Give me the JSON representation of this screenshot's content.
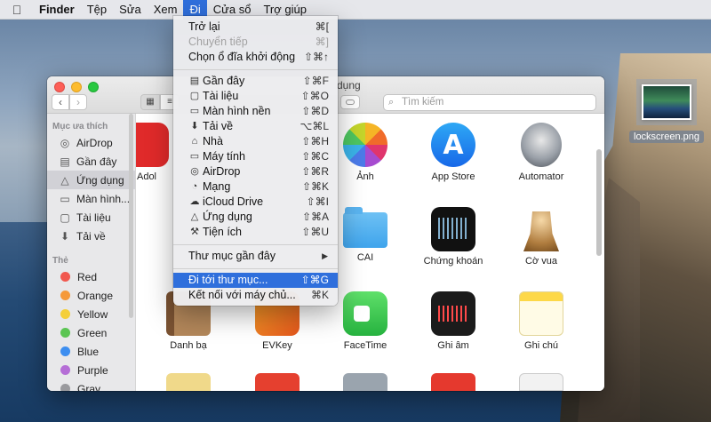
{
  "menubar": {
    "app": "Finder",
    "items": [
      "Tệp",
      "Sửa",
      "Xem",
      "Đi",
      "Cửa sổ",
      "Trợ giúp"
    ],
    "active": "Đi"
  },
  "window": {
    "title": "Ứng dụng",
    "title_visible": "dụng",
    "search_placeholder": "Tìm kiếm"
  },
  "sidebar": {
    "favorites_header": "Mục ưa thích",
    "favorites": [
      {
        "label": "AirDrop",
        "icon": "airdrop-icon"
      },
      {
        "label": "Gần đây",
        "icon": "recents-icon"
      },
      {
        "label": "Ứng dụng",
        "icon": "applications-icon",
        "selected": true
      },
      {
        "label": "Màn hình...",
        "icon": "desktop-icon"
      },
      {
        "label": "Tài liệu",
        "icon": "documents-icon"
      },
      {
        "label": "Tải về",
        "icon": "downloads-icon"
      }
    ],
    "tags_header": "Thẻ",
    "tags": [
      {
        "label": "Red",
        "color": "#f1584f"
      },
      {
        "label": "Orange",
        "color": "#f5993a"
      },
      {
        "label": "Yellow",
        "color": "#f4cf3b"
      },
      {
        "label": "Green",
        "color": "#5bc553"
      },
      {
        "label": "Blue",
        "color": "#3d8ef0"
      },
      {
        "label": "Purple",
        "color": "#b56ed6"
      },
      {
        "label": "Gray",
        "color": "#9a9a9e"
      }
    ]
  },
  "apps": {
    "row1": [
      "Adol",
      "Ảnh",
      "App Store",
      "Automator"
    ],
    "row2": [
      "CAI",
      "Chứng khoán",
      "Cờ vua"
    ],
    "row3": [
      "Danh bạ",
      "EVKey",
      "FaceTime",
      "Ghi âm",
      "Ghi chú"
    ]
  },
  "go_menu": {
    "items": [
      {
        "label": "Trở lại",
        "shortcut": "⌘["
      },
      {
        "label": "Chuyển tiếp",
        "shortcut": "⌘]",
        "disabled": true
      },
      {
        "label": "Chọn ổ đĩa khởi động",
        "shortcut": "⇧⌘↑"
      },
      {
        "label": "Gần đây",
        "shortcut": "⇧⌘F",
        "icon": "recents-icon"
      },
      {
        "label": "Tài liệu",
        "shortcut": "⇧⌘O",
        "icon": "documents-icon"
      },
      {
        "label": "Màn hình nền",
        "shortcut": "⇧⌘D",
        "icon": "desktop-icon"
      },
      {
        "label": "Tải về",
        "shortcut": "⌥⌘L",
        "icon": "downloads-icon"
      },
      {
        "label": "Nhà",
        "shortcut": "⇧⌘H",
        "icon": "home-icon"
      },
      {
        "label": "Máy tính",
        "shortcut": "⇧⌘C",
        "icon": "computer-icon"
      },
      {
        "label": "AirDrop",
        "shortcut": "⇧⌘R",
        "icon": "airdrop-icon"
      },
      {
        "label": "Mạng",
        "shortcut": "⇧⌘K",
        "icon": "network-icon"
      },
      {
        "label": "iCloud Drive",
        "shortcut": "⇧⌘I",
        "icon": "icloud-icon"
      },
      {
        "label": "Ứng dụng",
        "shortcut": "⇧⌘A",
        "icon": "applications-icon"
      },
      {
        "label": "Tiện ích",
        "shortcut": "⇧⌘U",
        "icon": "utilities-icon"
      },
      {
        "label": "Thư mục gần đây",
        "submenu": true
      },
      {
        "label": "Đi tới thư mục...",
        "shortcut": "⇧⌘G",
        "highlighted": true
      },
      {
        "label": "Kết nối với máy chủ...",
        "shortcut": "⌘K"
      }
    ]
  },
  "desktop": {
    "file_label": "lockscreen.png"
  },
  "colors": {
    "accent": "#2f6fdc",
    "menu_bg": "#ececee"
  }
}
